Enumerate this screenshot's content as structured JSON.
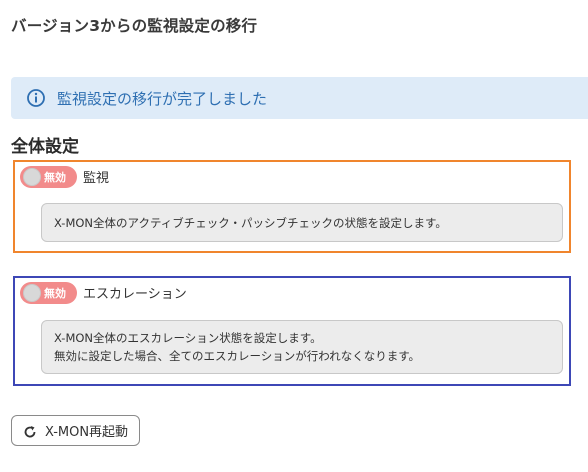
{
  "page": {
    "title": "バージョン3からの監視設定の移行"
  },
  "alert": {
    "icon": "info-icon",
    "message": "監視設定の移行が完了しました",
    "color": "#2e6fb2"
  },
  "section": {
    "title": "全体設定"
  },
  "settings": [
    {
      "toggle_label": "無効",
      "toggle_state": "off",
      "label": "監視",
      "description_lines": [
        "X-MON全体のアクティブチェック・パッシブチェックの状態を設定します。"
      ],
      "border_color": "#f0852d"
    },
    {
      "toggle_label": "無効",
      "toggle_state": "off",
      "label": "エスカレーション",
      "description_lines": [
        "X-MON全体のエスカレーション状態を設定します。",
        "無効に設定した場合、全てのエスカレーションが行われなくなります。"
      ],
      "border_color": "#3d47b6"
    }
  ],
  "restart_button": {
    "icon": "restart-icon",
    "label": "X-MON再起動"
  }
}
